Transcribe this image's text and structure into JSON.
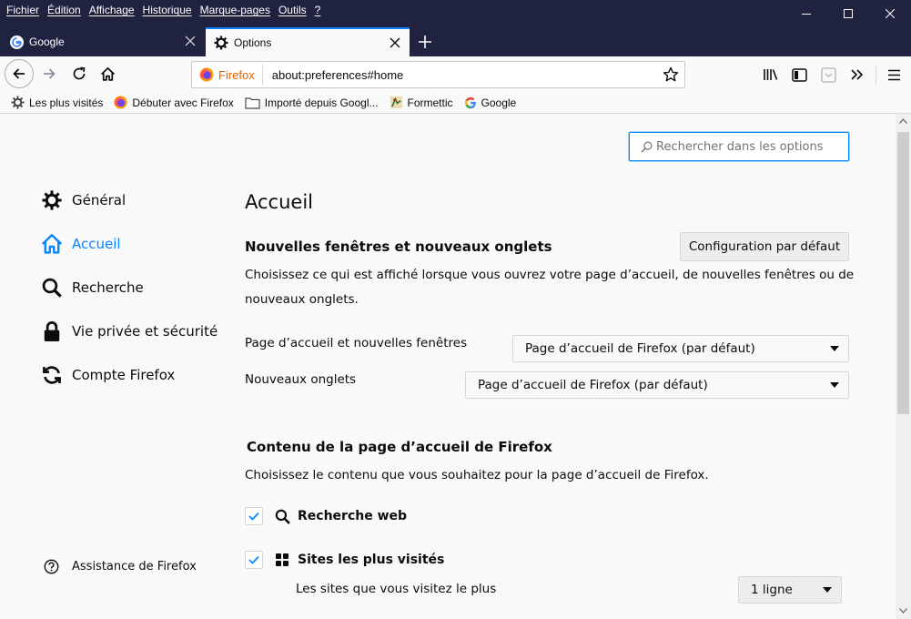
{
  "menu": [
    "Fichier",
    "Édition",
    "Affichage",
    "Historique",
    "Marque-pages",
    "Outils",
    "?"
  ],
  "tabs": [
    {
      "title": "Google",
      "icon": "google-icon"
    },
    {
      "title": "Options",
      "icon": "gear-icon",
      "active": true
    }
  ],
  "urlbar": {
    "identity": "Firefox",
    "url": "about:preferences#home"
  },
  "bookmarks": [
    {
      "label": "Les plus visités",
      "icon": "gear-icon"
    },
    {
      "label": "Débuter avec Firefox",
      "icon": "firefox-icon"
    },
    {
      "label": "Importé depuis Googl...",
      "icon": "folder-icon"
    },
    {
      "label": "Formettic",
      "icon": "formettic-icon"
    },
    {
      "label": "Google",
      "icon": "google-icon"
    }
  ],
  "search": {
    "placeholder": "Rechercher dans les options"
  },
  "sidebar": {
    "items": [
      {
        "label": "Général",
        "icon": "gear-icon"
      },
      {
        "label": "Accueil",
        "icon": "home-icon",
        "selected": true
      },
      {
        "label": "Recherche",
        "icon": "search-icon"
      },
      {
        "label": "Vie privée et sécurité",
        "icon": "lock-icon"
      },
      {
        "label": "Compte Firefox",
        "icon": "sync-icon"
      }
    ],
    "help": "Assistance de Firefox"
  },
  "main": {
    "title": "Accueil",
    "section1": {
      "title": "Nouvelles fenêtres et nouveaux onglets",
      "button": "Configuration par défaut",
      "desc_line1": "Choisissez ce qui est affiché lorsque vous ouvrez votre page d’accueil, de nouvelles fenêtres ou de",
      "desc_line2": "nouveaux onglets.",
      "homepage_label": "Page d’accueil et nouvelles fenêtres",
      "homepage_value": "Page d’accueil de Firefox (par défaut)",
      "newtab_label": "Nouveaux onglets",
      "newtab_value": "Page d’accueil de Firefox (par défaut)"
    },
    "section2": {
      "title": "Contenu de la page d’accueil de Firefox",
      "desc": "Choisissez le contenu que vous souhaitez pour la page d’accueil de Firefox.",
      "options": [
        {
          "label": "Recherche web",
          "checked": true,
          "icon": "search-icon"
        },
        {
          "label": "Sites les plus visités",
          "checked": true,
          "icon": "grid-icon",
          "sub": "Les sites que vous visitez le plus",
          "rows_value": "1 ligne"
        }
      ]
    }
  },
  "colors": {
    "accent": "#0a84ff",
    "titlebar": "#202340"
  }
}
